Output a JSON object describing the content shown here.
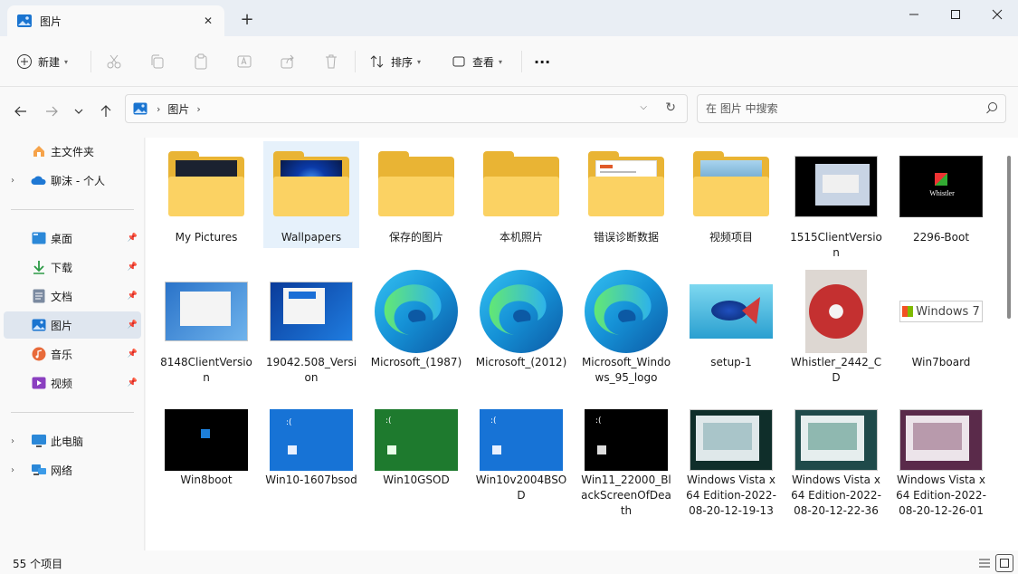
{
  "window": {
    "tab_title": "图片",
    "new_tab_symbol": "+",
    "close_tab_symbol": "✕"
  },
  "commands": {
    "new_label": "新建",
    "sort_label": "排序",
    "view_label": "查看",
    "more_label": "···"
  },
  "address": {
    "crumbs": [
      "图片"
    ],
    "search_placeholder": "在 图片 中搜索"
  },
  "sidebar": {
    "items": [
      {
        "label": "主文件夹",
        "icon": "home-icon"
      },
      {
        "label": "聊沫 - 个人",
        "icon": "onedrive-icon"
      },
      {
        "label": "桌面",
        "icon": "desktop-icon"
      },
      {
        "label": "下载",
        "icon": "download-icon"
      },
      {
        "label": "文档",
        "icon": "documents-icon"
      },
      {
        "label": "图片",
        "icon": "pictures-icon"
      },
      {
        "label": "音乐",
        "icon": "music-icon"
      },
      {
        "label": "视频",
        "icon": "videos-icon"
      },
      {
        "label": "此电脑",
        "icon": "this-pc-icon"
      },
      {
        "label": "网络",
        "icon": "network-icon"
      }
    ]
  },
  "content": {
    "items": [
      {
        "name": "My Pictures",
        "kind": "folder"
      },
      {
        "name": "Wallpapers",
        "kind": "folder"
      },
      {
        "name": "保存的图片",
        "kind": "folder"
      },
      {
        "name": "本机照片",
        "kind": "folder"
      },
      {
        "name": "错误诊断数据",
        "kind": "folder"
      },
      {
        "name": "视频项目",
        "kind": "folder"
      },
      {
        "name": "1515ClientVersion",
        "kind": "image"
      },
      {
        "name": "2296-Boot",
        "kind": "image"
      },
      {
        "name": "8148ClientVersion",
        "kind": "image"
      },
      {
        "name": "19042.508_Version",
        "kind": "image"
      },
      {
        "name": "Microsoft_(1987)",
        "kind": "edge"
      },
      {
        "name": "Microsoft_(2012)",
        "kind": "edge"
      },
      {
        "name": "Microsoft_Windows_95_logo",
        "kind": "edge"
      },
      {
        "name": "setup-1",
        "kind": "image"
      },
      {
        "name": "Whistler_2442_CD",
        "kind": "image"
      },
      {
        "name": "Win7board",
        "kind": "image"
      },
      {
        "name": "Win8boot",
        "kind": "image"
      },
      {
        "name": "Win10-1607bsod",
        "kind": "image"
      },
      {
        "name": "Win10GSOD",
        "kind": "image"
      },
      {
        "name": "Win10v2004BSOD",
        "kind": "image"
      },
      {
        "name": "Win11_22000_BlackScreenOfDeath",
        "kind": "image"
      },
      {
        "name": "Windows Vista x64 Edition-2022-08-20-12-19-13",
        "kind": "image"
      },
      {
        "name": "Windows Vista x64 Edition-2022-08-20-12-22-36",
        "kind": "image"
      },
      {
        "name": "Windows Vista x64 Edition-2022-08-20-12-26-01",
        "kind": "image"
      }
    ],
    "thumb_texts": {
      "whistler_logo": "Whistler",
      "win7_logo": "Windows 7"
    }
  },
  "status": {
    "item_count": "55 个项目"
  },
  "colors": {
    "accent": "#0067c0",
    "folder_back": "#e9b434",
    "folder_front": "#fbd263",
    "selection": "#e6f1fb"
  }
}
